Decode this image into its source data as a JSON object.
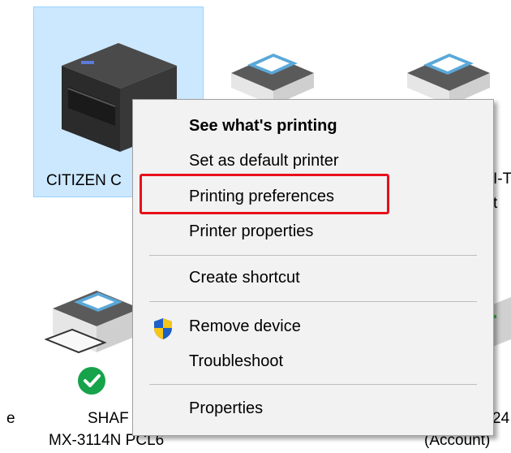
{
  "devices": {
    "citizen_label": "CITIZEN C",
    "right_label_line1": "I-T",
    "right_label_line2": "t",
    "sharp_label_line1": "SHAF",
    "sharp_label_line2": "MX-3114N PCL6",
    "left_edge_label": "e",
    "right_bottom_line1": "24",
    "right_bottom_line2": "(Account)"
  },
  "context_menu": {
    "items": [
      {
        "label": "See what's printing",
        "bold": true
      },
      {
        "label": "Set as default printer"
      },
      {
        "label": "Printing preferences",
        "highlighted": true
      },
      {
        "label": "Printer properties"
      },
      {
        "label": "Create shortcut"
      },
      {
        "label": "Remove device",
        "icon": "shield-icon"
      },
      {
        "label": "Troubleshoot"
      },
      {
        "label": "Properties"
      }
    ]
  },
  "colors": {
    "selection": "#cce8ff",
    "highlight_box": "#e8101a",
    "default_check": "#16a34a"
  }
}
